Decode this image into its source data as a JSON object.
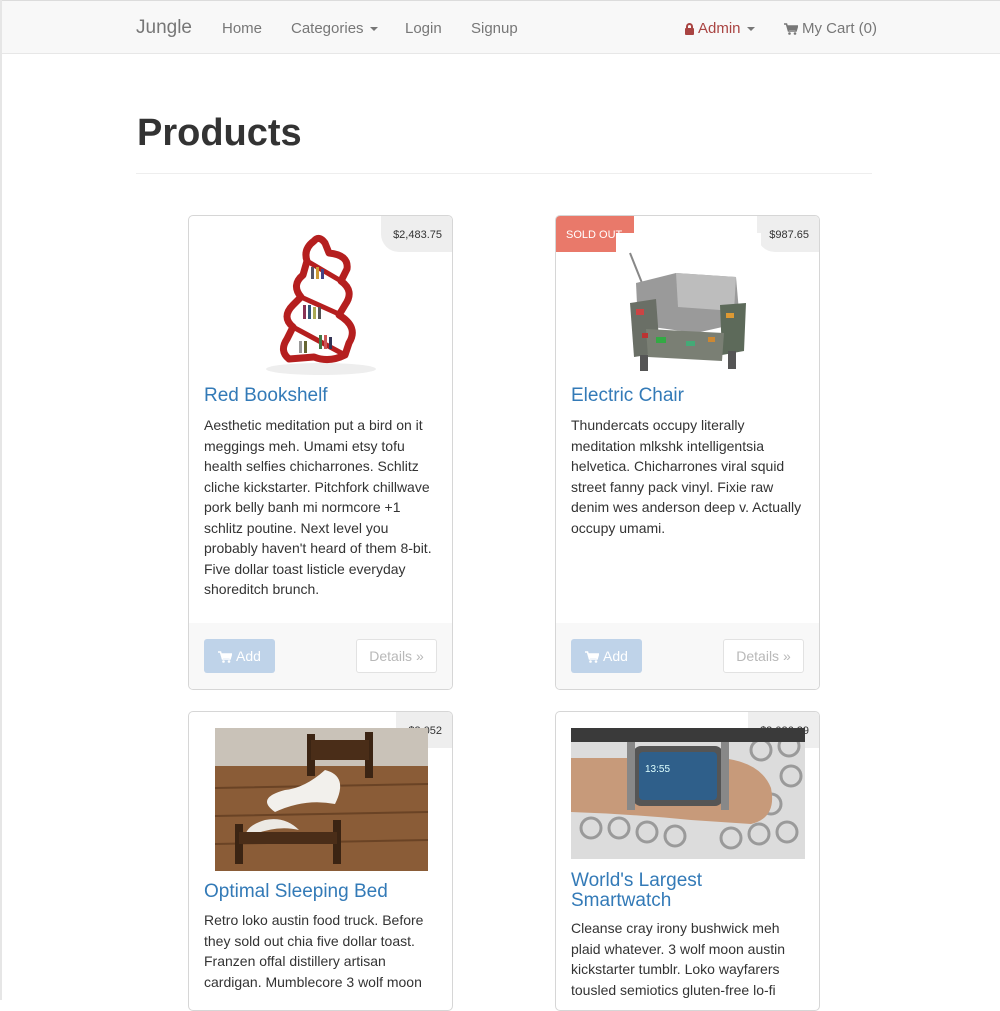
{
  "navbar": {
    "brand": "Jungle",
    "links": {
      "home": "Home",
      "categories": "Categories",
      "login": "Login",
      "signup": "Signup"
    },
    "admin": "Admin",
    "cart": "My Cart (0)",
    "accent_color": "#a94442"
  },
  "page": {
    "title": "Products"
  },
  "products": [
    {
      "name": "Red Bookshelf",
      "price": "$2,483.75",
      "description": "Aesthetic meditation put a bird on it meggings meh. Umami etsy tofu health selfies chicharrones. Schlitz cliche kickstarter. Pitchfork chillwave pork belly banh mi normcore +1 schlitz poutine. Next level you probably haven't heard of them 8-bit. Five dollar toast listicle everyday shoreditch brunch.",
      "add_label": "Add",
      "details_label": "Details »"
    },
    {
      "name": "Electric Chair",
      "price": "$987.65",
      "badge": "SOLD OUT",
      "description": "Thundercats occupy literally meditation mlkshk intelligentsia helvetica. Chicharrones viral squid street fanny pack vinyl. Fixie raw denim wes anderson deep v. Actually occupy umami.",
      "add_label": "Add",
      "details_label": "Details »"
    },
    {
      "name": "Optimal Sleeping Bed",
      "price": "$3,052",
      "description": "Retro loko austin food truck. Before they sold out chia five dollar toast. Franzen offal distillery artisan cardigan. Mumblecore 3 wolf moon"
    },
    {
      "name": "World's Largest Smartwatch",
      "price": "$2,026.29",
      "description": "Cleanse cray irony bushwick meh plaid whatever. 3 wolf moon austin kickstarter tumblr. Loko wayfarers tousled semiotics gluten-free lo-fi"
    }
  ],
  "colors": {
    "link": "#337ab7",
    "sold_out": "#e9796a",
    "add_button": "#bfd3e9",
    "price_tag": "#eeeeee"
  }
}
